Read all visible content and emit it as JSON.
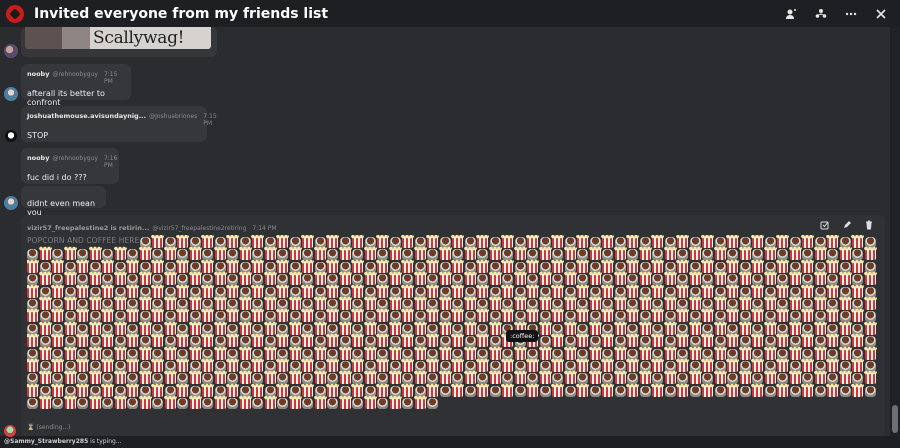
{
  "header": {
    "title": "Invited everyone from my friends list",
    "accent_color": "#c81d1d"
  },
  "image_message": {
    "caption_text": "Scallywag!"
  },
  "messages": [
    {
      "author": "nooby",
      "handle": "@rehnoobyguy",
      "time": "7:15 PM",
      "text": "afterall its better to confront"
    },
    {
      "author": "Joshuathemouse.avisundaynig...",
      "handle": "@Joshuabriones",
      "time": "7:15 PM",
      "text": "STOP"
    },
    {
      "author": "nooby",
      "handle": "@rehnoobyguy",
      "time": "7:16 PM",
      "text": "fuc did i do ???"
    },
    {
      "author": "",
      "handle": "",
      "time": "",
      "text": "didnt even mean you"
    }
  ],
  "big_message": {
    "author": "vizir57_freepalestine2 is retirin...",
    "handle": "@vizir57_freepalestine2retiring",
    "time": "7:14 PM",
    "text": "POPCORN AND COFFEE HERE",
    "status": "(sending...)",
    "emoji_icons": [
      "popcorn-icon",
      "coffee-icon"
    ]
  },
  "tooltip": {
    "text": ":coffee:"
  },
  "typing_indicator": {
    "user": "@Sammy_Strawberry285",
    "suffix": " is typing..."
  }
}
